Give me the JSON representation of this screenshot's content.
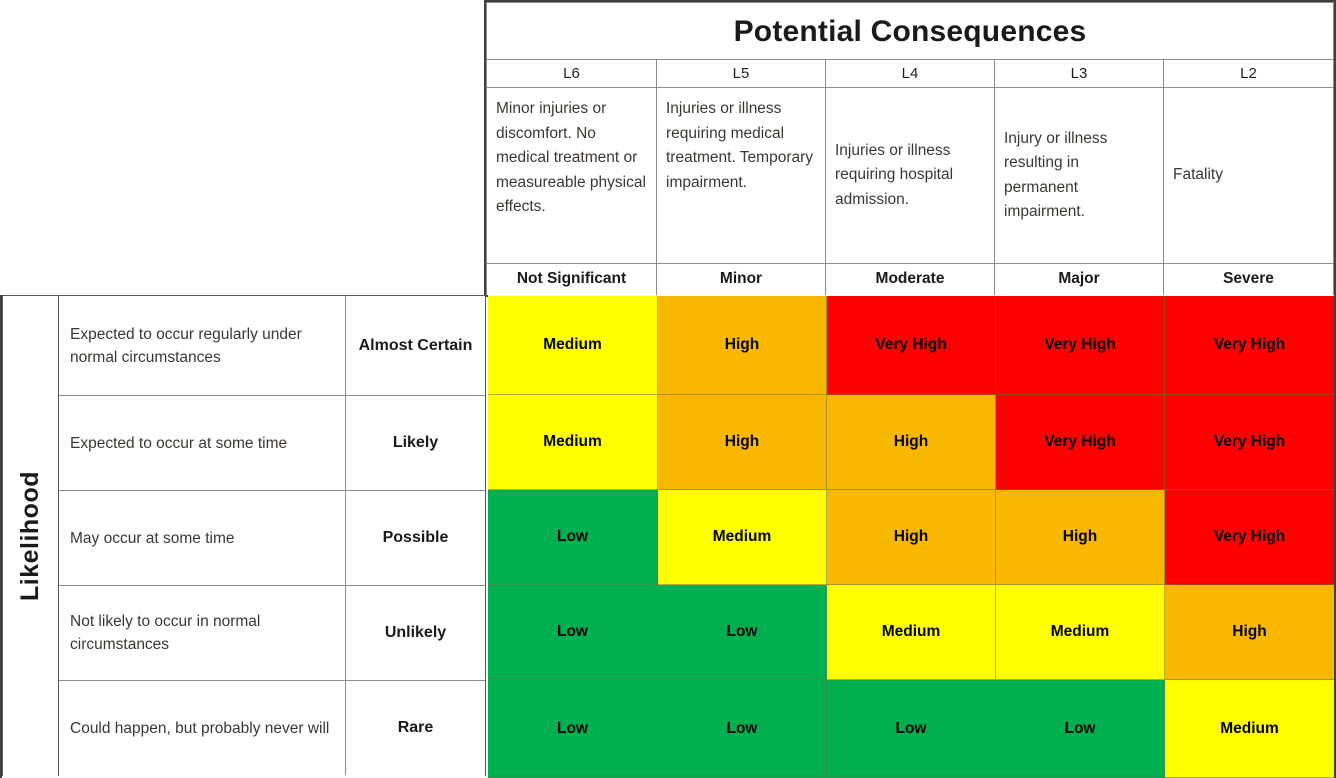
{
  "header": {
    "title": "Potential Consequences",
    "codes": [
      "L6",
      "L5",
      "L4",
      "L3",
      "L2"
    ],
    "descriptions": [
      "Minor injuries or discomfort. No medical treatment or measureable physical effects.",
      "Injuries or illness requiring medical treatment. Temporary impairment.",
      "Injuries or illness requiring hospital admission.",
      "Injury or illness resulting in permanent impairment.",
      "Fatality"
    ],
    "severities": [
      "Not Significant",
      "Minor",
      "Moderate",
      "Major",
      "Severe"
    ]
  },
  "likelihood": {
    "axis_label": "Likelihood",
    "rows": [
      {
        "description": "Expected to occur regularly under normal circumstances",
        "rating": "Almost Certain"
      },
      {
        "description": "Expected to occur at some time",
        "rating": "Likely"
      },
      {
        "description": "May occur at some time",
        "rating": "Possible"
      },
      {
        "description": "Not likely to occur in normal circumstances",
        "rating": "Unlikely"
      },
      {
        "description": "Could happen, but probably never will",
        "rating": "Rare"
      }
    ]
  },
  "colors": {
    "low": "#00B050",
    "medium": "#FFFF00",
    "high": "#F9B800",
    "very_high": "#FE0000",
    "border": "#8C8C8C",
    "outer_border": "#3F3F3F"
  },
  "chart_data": {
    "type": "heatmap",
    "title": "Potential Consequences",
    "xlabel": "Potential Consequences",
    "ylabel": "Likelihood",
    "x_categories": [
      "Not Significant",
      "Minor",
      "Moderate",
      "Major",
      "Severe"
    ],
    "x_codes": [
      "L6",
      "L5",
      "L4",
      "L3",
      "L2"
    ],
    "y_categories": [
      "Almost Certain",
      "Likely",
      "Possible",
      "Unlikely",
      "Rare"
    ],
    "legend": [
      "Low",
      "Medium",
      "High",
      "Very High"
    ],
    "legend_position": "none",
    "grid": true,
    "cells": [
      [
        {
          "label": "Medium",
          "level": "medium",
          "color": "#FFFF00"
        },
        {
          "label": "High",
          "level": "high",
          "color": "#F9B800"
        },
        {
          "label": "Very High",
          "level": "very_high",
          "color": "#FE0000"
        },
        {
          "label": "Very High",
          "level": "very_high",
          "color": "#FE0000"
        },
        {
          "label": "Very High",
          "level": "very_high",
          "color": "#FE0000"
        }
      ],
      [
        {
          "label": "Medium",
          "level": "medium",
          "color": "#FFFF00"
        },
        {
          "label": "High",
          "level": "high",
          "color": "#F9B800"
        },
        {
          "label": "High",
          "level": "high",
          "color": "#F9B800"
        },
        {
          "label": "Very High",
          "level": "very_high",
          "color": "#FE0000"
        },
        {
          "label": "Very High",
          "level": "very_high",
          "color": "#FE0000"
        }
      ],
      [
        {
          "label": "Low",
          "level": "low",
          "color": "#00B050"
        },
        {
          "label": "Medium",
          "level": "medium",
          "color": "#FFFF00"
        },
        {
          "label": "High",
          "level": "high",
          "color": "#F9B800"
        },
        {
          "label": "High",
          "level": "high",
          "color": "#F9B800"
        },
        {
          "label": "Very High",
          "level": "very_high",
          "color": "#FE0000"
        }
      ],
      [
        {
          "label": "Low",
          "level": "low",
          "color": "#00B050"
        },
        {
          "label": "Low",
          "level": "low",
          "color": "#00B050"
        },
        {
          "label": "Medium",
          "level": "medium",
          "color": "#FFFF00"
        },
        {
          "label": "Medium",
          "level": "medium",
          "color": "#FFFF00"
        },
        {
          "label": "High",
          "level": "high",
          "color": "#F9B800"
        }
      ],
      [
        {
          "label": "Low",
          "level": "low",
          "color": "#00B050"
        },
        {
          "label": "Low",
          "level": "low",
          "color": "#00B050"
        },
        {
          "label": "Low",
          "level": "low",
          "color": "#00B050"
        },
        {
          "label": "Low",
          "level": "low",
          "color": "#00B050"
        },
        {
          "label": "Medium",
          "level": "medium",
          "color": "#FFFF00"
        }
      ]
    ]
  }
}
